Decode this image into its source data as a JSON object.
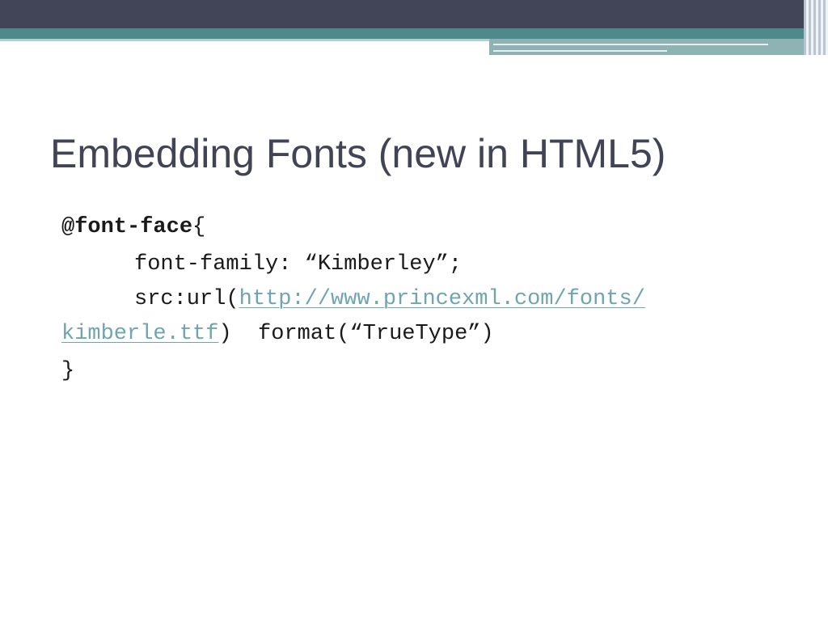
{
  "slide": {
    "title": "Embedding Fonts (new in HTML5)",
    "code": {
      "at_rule": "@font-face",
      "open_brace": "{",
      "font_family_line": "font-family: “Kimberley”;",
      "src_prefix": "src:url(",
      "url_part1": "http://www.princexml.com/fonts/",
      "url_part2": "kimberle.ttf",
      "src_suffix": ")  format(“TrueType”)",
      "close_brace": "}"
    }
  },
  "colors": {
    "title": "#414455",
    "link": "#6fa5b0",
    "band_dark": "#424457",
    "band_teal": "#4e8a8b"
  }
}
